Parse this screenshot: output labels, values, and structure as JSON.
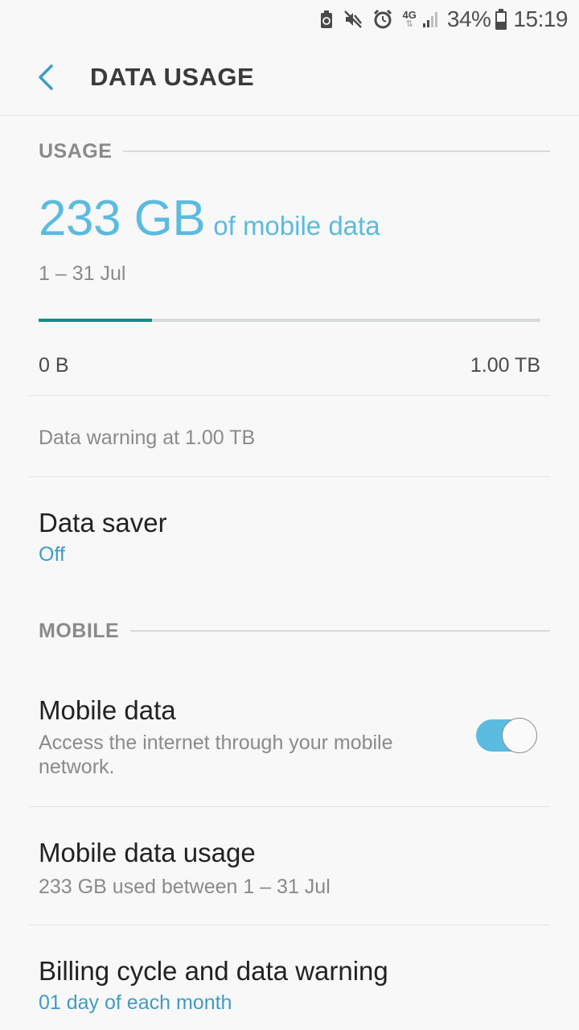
{
  "status_bar": {
    "network": "4G",
    "battery": "34%",
    "time": "15:19"
  },
  "app_bar": {
    "title": "DATA USAGE"
  },
  "usage_section": {
    "header": "USAGE",
    "amount": "233 GB",
    "amount_suffix": "of mobile data",
    "period": "1 – 31 Jul",
    "progress_fraction": 0.226,
    "range_min": "0 B",
    "range_max": "1.00 TB",
    "warning": "Data warning at 1.00 TB"
  },
  "data_saver": {
    "title": "Data saver",
    "status": "Off"
  },
  "mobile_section": {
    "header": "MOBILE",
    "mobile_data": {
      "title": "Mobile data",
      "description": "Access the internet through your mobile network.",
      "enabled": true
    },
    "mobile_data_usage": {
      "title": "Mobile data usage",
      "description": "233 GB used between 1 – 31 Jul"
    },
    "billing_cycle": {
      "title": "Billing cycle and data warning",
      "description": "01 day of each month"
    }
  },
  "colors": {
    "accent": "#5bbbe0",
    "link": "#3f9cc3",
    "progress": "#138c85"
  }
}
